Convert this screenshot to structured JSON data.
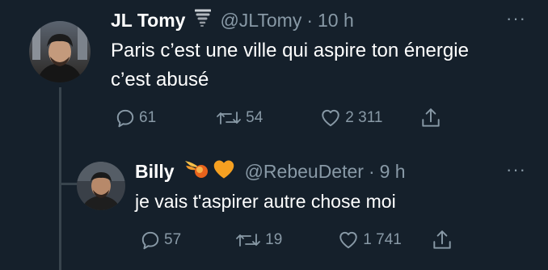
{
  "tweet": {
    "display_name": "JL Tomy",
    "name_badge_icon": "tornado-icon",
    "handle": "@JLTomy",
    "separator": "·",
    "time": "10 h",
    "more_label": "···",
    "text_line1": "Paris c’est une ville qui aspire ton énergie",
    "text_line2": "c’est abusé",
    "replies": "61",
    "retweets": "54",
    "likes": "2 311"
  },
  "reply": {
    "display_name": "Billy",
    "name_badge_icons": [
      "fireball-icon",
      "orange-heart-icon"
    ],
    "handle": "@RebeuDeter",
    "separator": "·",
    "time": "9 h",
    "more_label": "···",
    "text": "je vais t'aspirer autre chose moi",
    "replies": "57",
    "retweets": "19",
    "likes": "1 741"
  },
  "colors": {
    "background": "#15202b",
    "secondary_text": "#8899a6",
    "thread_line": "#38444d",
    "primary_text": "#ffffff",
    "heart_orange": "#f5a021"
  }
}
